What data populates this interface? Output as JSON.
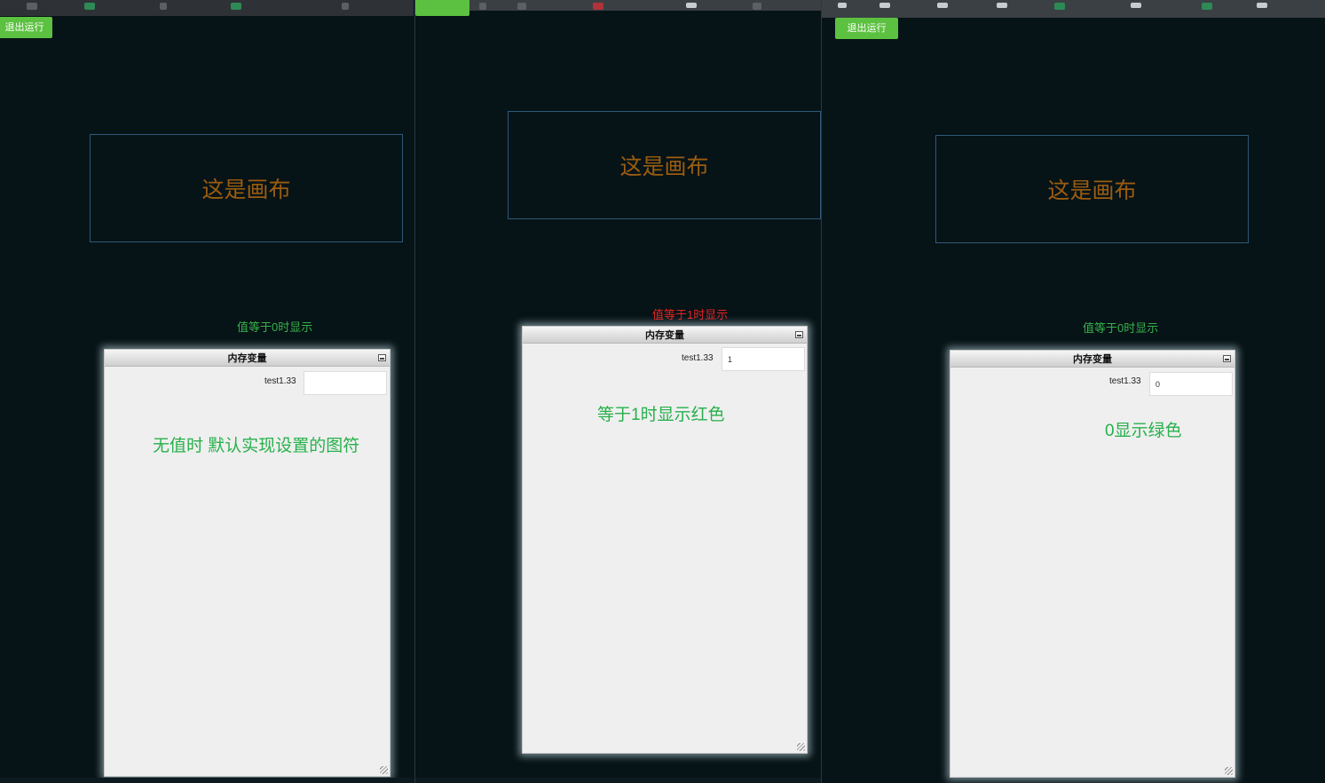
{
  "colors": {
    "background": "#061317",
    "exit_button": "#5cc140",
    "canvas_border": "#2f5978",
    "canvas_text": "#9a5c10",
    "green_text": "#27b04b",
    "red_text": "#e52222"
  },
  "panels": [
    {
      "exit_button": "退出运行",
      "canvas_text": "这是画布",
      "condition_label": "值等于0时显示",
      "window": {
        "title": "内存变量",
        "variable_name": "test1.33",
        "variable_value": ""
      },
      "note": "无值时 默认实现设置的图符"
    },
    {
      "exit_button": "",
      "canvas_text": "这是画布",
      "condition_label": "值等于1时显示",
      "window": {
        "title": "内存变量",
        "variable_name": "test1.33",
        "variable_value": "1"
      },
      "note": "等于1时显示红色"
    },
    {
      "exit_button": "退出运行",
      "canvas_text": "这是画布",
      "condition_label": "值等于0时显示",
      "window": {
        "title": "内存变量",
        "variable_name": "test1.33",
        "variable_value": "0"
      },
      "note": "0显示绿色"
    }
  ]
}
